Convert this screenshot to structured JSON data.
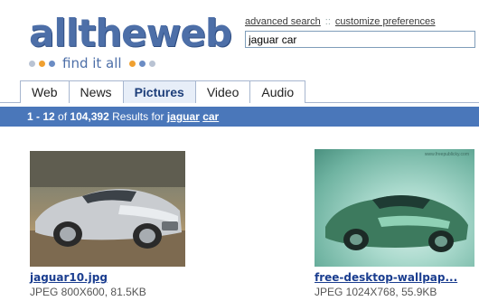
{
  "logo": {
    "word": "alltheweb",
    "tagline": "find it all",
    "colors": {
      "brand": "#4d6fa8",
      "accent": "#f0a030"
    }
  },
  "toplinks": {
    "advanced": "advanced search",
    "sep": "::",
    "customize": "customize preferences"
  },
  "search": {
    "value": "jaguar car"
  },
  "tabs": [
    {
      "label": "Web"
    },
    {
      "label": "News"
    },
    {
      "label": "Pictures",
      "active": true
    },
    {
      "label": "Video"
    },
    {
      "label": "Audio"
    }
  ],
  "resultsbar": {
    "range": "1 - 12",
    "of": "of",
    "total": "104,392",
    "results_for": "Results for",
    "term1": "jaguar",
    "term2": "car"
  },
  "results": [
    {
      "filename": "jaguar10.jpg",
      "meta": "JPEG 800X600, 81.5KB"
    },
    {
      "filename": "free-desktop-wallpap...",
      "meta": "JPEG 1024X768, 55.9KB",
      "watermark": "www.freepublicky.com"
    }
  ]
}
